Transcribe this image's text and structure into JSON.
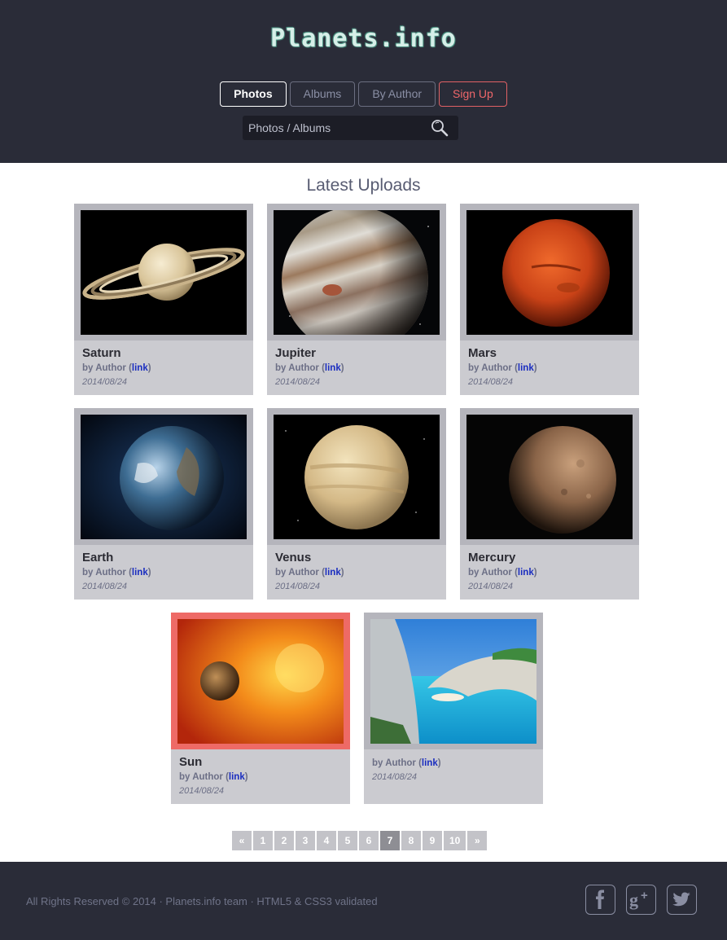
{
  "header": {
    "logo": "Planets.info",
    "nav": [
      {
        "label": "Photos",
        "active": true
      },
      {
        "label": "Albums",
        "active": false
      },
      {
        "label": "By Author",
        "active": false
      },
      {
        "label": "Sign Up",
        "active": false
      }
    ],
    "search": {
      "placeholder": "Photos / Albums",
      "icon": "search-icon"
    }
  },
  "main": {
    "title": "Latest Uploads",
    "cards": [
      {
        "name": "Saturn",
        "by_prefix": "by Author (",
        "link": "link",
        "by_suffix": ")",
        "date": "2014/08/24",
        "image": "saturn"
      },
      {
        "name": "Jupiter",
        "by_prefix": "by Author (",
        "link": "link",
        "by_suffix": ")",
        "date": "2014/08/24",
        "image": "jupiter"
      },
      {
        "name": "Mars",
        "by_prefix": "by Author (",
        "link": "link",
        "by_suffix": ")",
        "date": "2014/08/24",
        "image": "mars"
      },
      {
        "name": "Earth",
        "by_prefix": "by Author (",
        "link": "link",
        "by_suffix": ")",
        "date": "2014/08/24",
        "image": "earth"
      },
      {
        "name": "Venus",
        "by_prefix": "by Author (",
        "link": "link",
        "by_suffix": ")",
        "date": "2014/08/24",
        "image": "venus"
      },
      {
        "name": "Mercury",
        "by_prefix": "by Author (",
        "link": "link",
        "by_suffix": ")",
        "date": "2014/08/24",
        "image": "mercury"
      },
      {
        "name": "Sun",
        "by_prefix": "by Author (",
        "link": "link",
        "by_suffix": ")",
        "date": "2014/08/24",
        "image": "sun",
        "highlighted": true
      },
      {
        "name": "",
        "by_prefix": "by Author (",
        "link": "link",
        "by_suffix": ")",
        "date": "2014/08/24",
        "image": "beach"
      }
    ]
  },
  "pagination": {
    "prev": "«",
    "pages": [
      "1",
      "2",
      "3",
      "4",
      "5",
      "6",
      "7",
      "8",
      "9",
      "10"
    ],
    "current": "7",
    "next": "»"
  },
  "footer": {
    "copyright": "All Rights Reserved © 2014 · Planets.info team · HTML5 & CSS3 validated",
    "social": [
      "facebook-icon",
      "google-plus-icon",
      "twitter-icon"
    ]
  },
  "colors": {
    "header_bg": "#2a2c38",
    "accent_red": "#f0676a",
    "link_blue": "#1a2dc0",
    "card_bg": "#cbcbd0",
    "current_page": "#8e8e94"
  }
}
